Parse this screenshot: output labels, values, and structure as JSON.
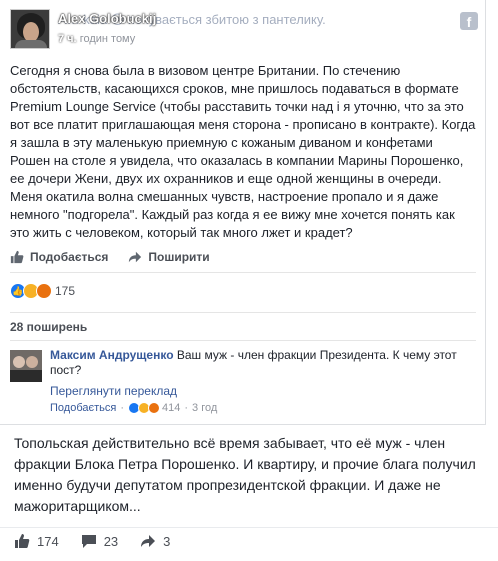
{
  "post": {
    "watermark_name": "Alex Golobuckij",
    "author_line": "А…                   kaia 😢 почувається збитою з пантелику.",
    "time_prefix": "7 ч.",
    "time": "годин тому",
    "text": "Сегодня я снова была в визовом центре Британии. По стечению обстоятельств, касающихся сроков, мне пришлось подаваться в формате Premium Lounge Service (чтобы расставить точки над і я уточню, что за это вот все платит приглашающая меня сторона - прописано в контракте). Когда я зашла в эту маленькую приемную с кожаным диваном и конфетами Рошен на столе я увидела, что оказалась в компании Марины Порошенко, ее дочери Жени, двух их охранников и еще одной женщины в очереди. Меня окатила волна смешанных чувств, настроение пропало и я даже немного \"подгорела\". Каждый раз когда я ее вижу мне хочется понять как это жить с человеком, который так много лжет и крадет?",
    "like_label": "Подобається",
    "share_label": "Поширити",
    "reaction_count": "175",
    "shares_label": "28 поширень",
    "fb_icon": "facebook-icon"
  },
  "comment": {
    "author": "Максим Андрущенко",
    "text": "Ваш муж - член фракции Президента. К чему этот пост?",
    "translate_label": "Переглянути переклад",
    "like_label": "Подобається",
    "reaction_count": "414",
    "age": "3 год"
  },
  "caption": "Топольская действительно всё время забывает, что её муж - член фракции Блока Петра Порошенко. И квартиру, и прочие блага получил именно будучи депутатом пропрезидентской фракции. И даже не мажоритарщиком...",
  "footer": {
    "likes": "174",
    "comments": "23",
    "shares": "3"
  },
  "colors": {
    "link": "#365899",
    "like_blue": "#1877f2",
    "haha_yellow": "#f7b125",
    "angry_orange": "#e9710f"
  }
}
